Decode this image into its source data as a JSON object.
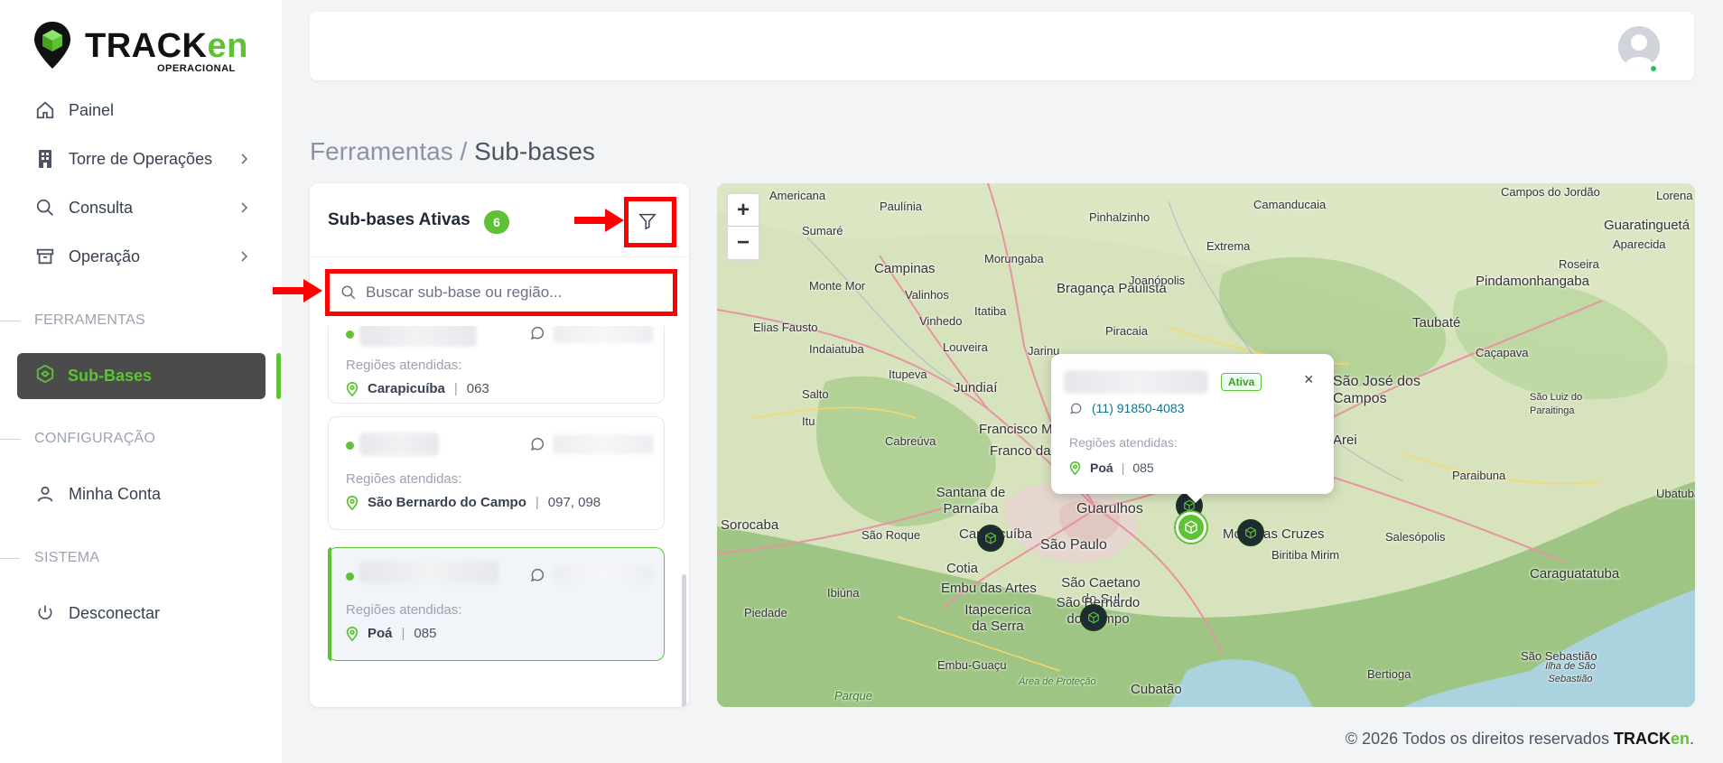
{
  "brand": {
    "name_main": "TRACK",
    "name_accent": "en",
    "subtitle": "OPERACIONAL"
  },
  "sidebar": {
    "items": [
      {
        "label": "Painel",
        "icon": "home-icon"
      },
      {
        "label": "Torre de Operações",
        "icon": "building-icon"
      },
      {
        "label": "Consulta",
        "icon": "search-icon"
      },
      {
        "label": "Operação",
        "icon": "archive-icon"
      }
    ],
    "section_tools": "FERRAMENTAS",
    "active_item": {
      "label": "Sub-Bases",
      "icon": "hexagon-icon"
    },
    "section_config": "CONFIGURAÇÃO",
    "account_item": {
      "label": "Minha Conta",
      "icon": "user-icon"
    },
    "section_system": "SISTEMA",
    "logout_item": {
      "label": "Desconectar",
      "icon": "power-icon"
    }
  },
  "breadcrumb": {
    "parent": "Ferramentas",
    "separator": " / ",
    "current": "Sub-bases"
  },
  "panel": {
    "title": "Sub-bases Ativas",
    "count": "6",
    "search_placeholder": "Buscar sub-base ou região...",
    "cards": [
      {
        "regions_label": "Regiões atendidas:",
        "city": "Carapicuíba",
        "codes": "063"
      },
      {
        "regions_label": "Regiões atendidas:",
        "city": "São Bernardo do Campo",
        "codes": "097, 098"
      },
      {
        "regions_label": "Regiões atendidas:",
        "city": "Poá",
        "codes": "085"
      }
    ]
  },
  "map": {
    "zoom_in": "+",
    "zoom_out": "−",
    "labels": [
      "Americana",
      "Paulínia",
      "Sumaré",
      "Campinas",
      "Monte Mor",
      "Valinhos",
      "Vinhedo",
      "Elias Fausto",
      "Indaiatuba",
      "Itupeva",
      "Salto",
      "Itu",
      "Cabreúva",
      "Jundiaí",
      "Louveira",
      "Itatiba",
      "Jarinu",
      "Morungaba",
      "Pinhalzinho",
      "Bragança Paulista",
      "Joanópolis",
      "Piracaia",
      "Extrema",
      "Camanducaia",
      "Campos do Jordão",
      "Lorena",
      "Guaratinguetá",
      "Aparecida",
      "Roseira",
      "Pindamonhangaba",
      "Taubaté",
      "Caçapava",
      "São José dos Campos",
      "São Luiz do Paraitinga",
      "Paraibuna",
      "Ubatuba",
      "Caraguatatuba",
      "Salesópolis",
      "Biritiba Mirim",
      "Mogi das Cruzes",
      "Guarulhos",
      "São Paulo",
      "São Caetano do Sul",
      "São Bernardo do Campo",
      "Francisco M",
      "Franco da",
      "Santana de Parnaíba",
      "Carapicuíba",
      "Cotia",
      "Embu das Artes",
      "Itapecerica da Serra",
      "São Roque",
      "Ibiúna",
      "Piedade",
      "Sorocaba",
      "Embu-Guaçu",
      "Cubatão",
      "Bertioga",
      "São Sebastião",
      "Ilha de São Sebastião",
      "Parque",
      "Área de Proteção",
      "Arei"
    ],
    "popup": {
      "status": "Ativa",
      "close": "×",
      "phone": "(11) 91850-4083",
      "regions_label": "Regiões atendidas:",
      "city": "Poá",
      "codes": "085"
    }
  },
  "footer": {
    "text": "© 2026 Todos os direitos reservados ",
    "brand_main": "TRACK",
    "brand_accent": "en",
    "period": "."
  },
  "colors": {
    "accent": "#5ec234",
    "highlight": "#ff0000",
    "active_bg": "#4b4b4b"
  }
}
